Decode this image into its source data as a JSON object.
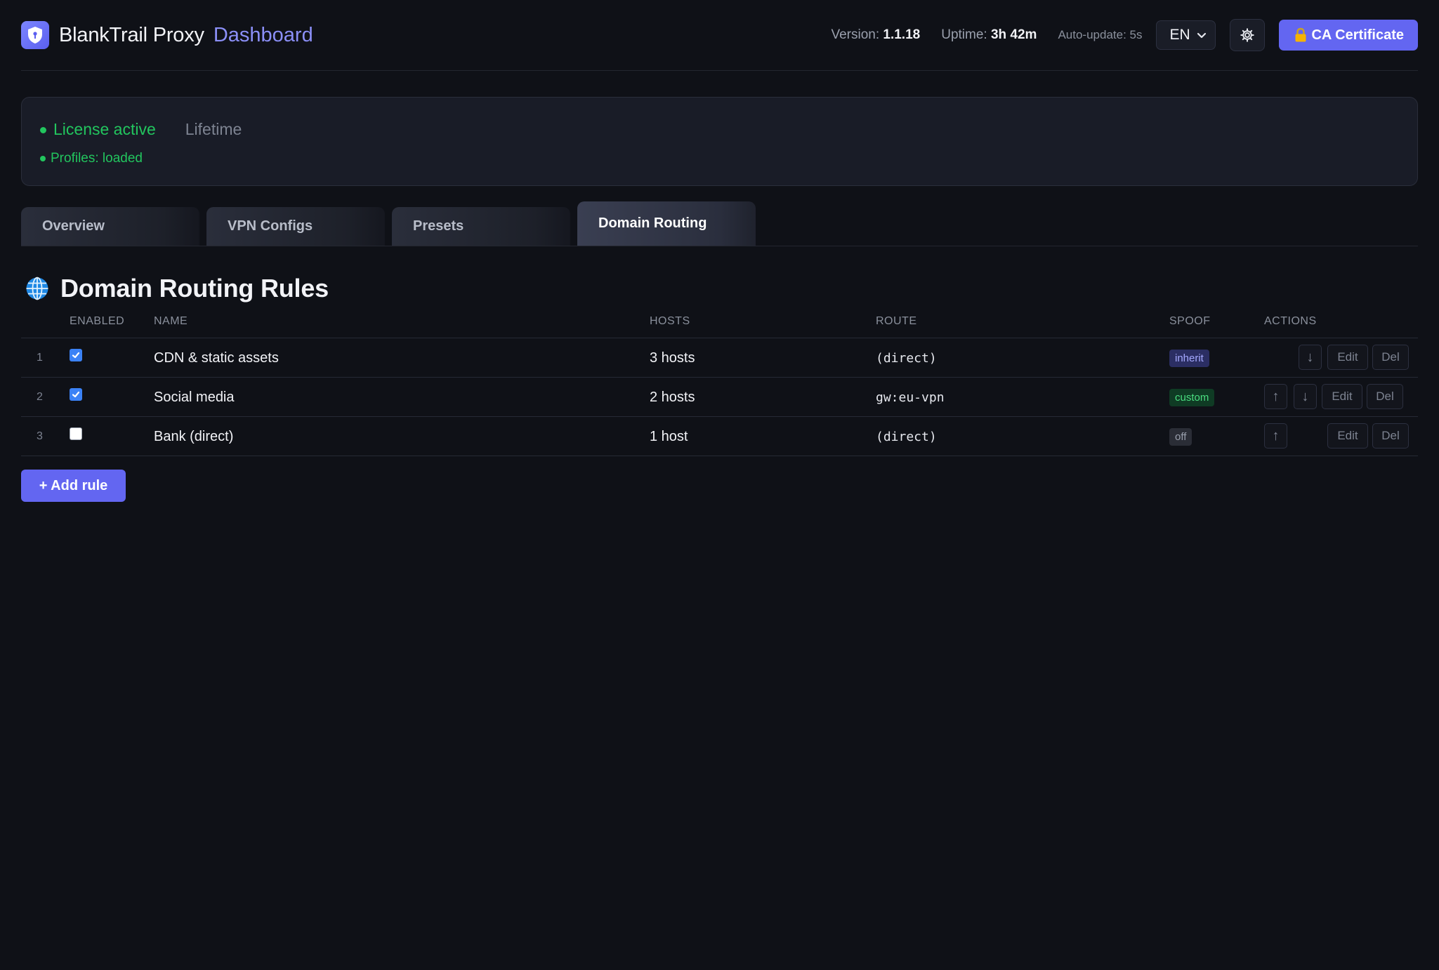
{
  "header": {
    "brand": "BlankTrail Proxy",
    "subtitle": "Dashboard",
    "version_label": "Version:",
    "version_value": "1.1.18",
    "uptime_label": "Uptime:",
    "uptime_value": "3h 42m",
    "autoupdate": "Auto-update: 5s",
    "language": "EN",
    "ca_button": "CA Certificate",
    "icons": {
      "logo": "shield-icon",
      "settings": "gear-icon",
      "ca": "lock-icon",
      "language": "chevron-down-icon"
    }
  },
  "license": {
    "status": "License active",
    "type": "Lifetime",
    "profiles": "Profiles: loaded",
    "status_color": "#22c55e"
  },
  "tabs": [
    {
      "label": "Overview",
      "active": false
    },
    {
      "label": "VPN Configs",
      "active": false
    },
    {
      "label": "Presets",
      "active": false
    },
    {
      "label": "Domain Routing",
      "active": true
    }
  ],
  "section": {
    "title": "Domain Routing Rules",
    "icon": "globe-icon"
  },
  "table": {
    "columns": {
      "enabled": "ENABLED",
      "name": "NAME",
      "hosts": "HOSTS",
      "route": "ROUTE",
      "spoof": "SPOOF",
      "actions": "ACTIONS"
    },
    "rows": [
      {
        "index": "1",
        "enabled": true,
        "name": "CDN & static assets",
        "hosts": "3 hosts",
        "route": "(direct)",
        "spoof": "inherit",
        "up": false,
        "down": true
      },
      {
        "index": "2",
        "enabled": true,
        "name": "Social media",
        "hosts": "2 hosts",
        "route": "gw:eu-vpn",
        "spoof": "custom",
        "up": true,
        "down": true
      },
      {
        "index": "3",
        "enabled": false,
        "name": "Bank (direct)",
        "hosts": "1 host",
        "route": "(direct)",
        "spoof": "off",
        "up": true,
        "down": false
      }
    ],
    "actions": {
      "up": "↑",
      "down": "↓",
      "edit": "Edit",
      "delete": "Del"
    }
  },
  "add_button": "+ Add rule",
  "colors": {
    "accent": "#6366f1",
    "background": "#0f1117",
    "success": "#22c55e",
    "checkbox": "#3b82f6"
  }
}
